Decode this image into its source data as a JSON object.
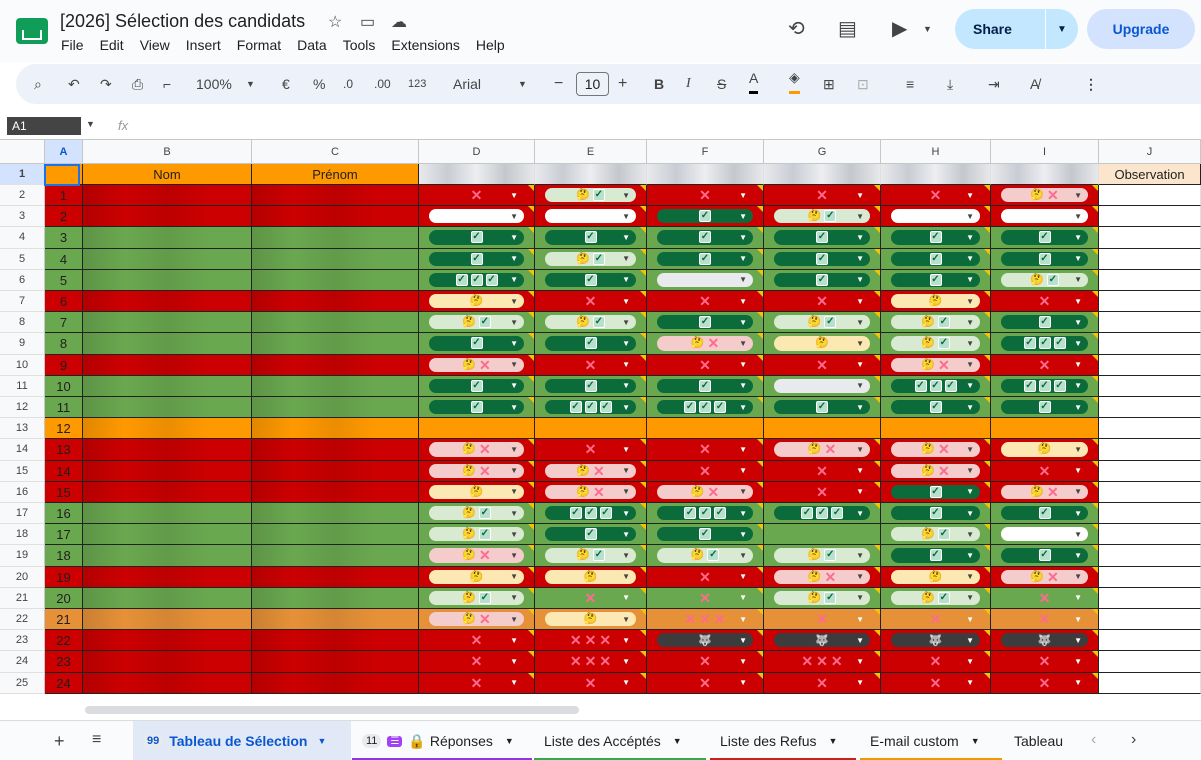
{
  "doc": {
    "title": "[2026] Sélection des candidats",
    "menu": [
      "File",
      "Edit",
      "View",
      "Insert",
      "Format",
      "Data",
      "Tools",
      "Extensions",
      "Help"
    ],
    "share_label": "Share",
    "upgrade_label": "Upgrade"
  },
  "toolbar": {
    "zoom": "100%",
    "currency": "€",
    "percent": "%",
    "dec_less": ".0",
    "dec_more": ".00",
    "number_format": "123",
    "font": "Arial",
    "font_size": "10",
    "minus": "−",
    "plus": "+"
  },
  "formula_bar": {
    "name_box": "A1",
    "fx": "fx",
    "content": ""
  },
  "columns": [
    "A",
    "B",
    "C",
    "D",
    "E",
    "F",
    "G",
    "H",
    "I",
    "J"
  ],
  "header_row": {
    "row_num": "1",
    "nom": "Nom",
    "prenom": "Prénom",
    "observation": "Observation"
  },
  "rows": [
    {
      "r": "2",
      "id": "1",
      "c": [
        "X",
        "MK",
        "X",
        "X",
        "X",
        "MX"
      ]
    },
    {
      "r": "3",
      "id": "2",
      "c": [
        "E",
        "E",
        "K",
        "MK",
        "E",
        "E"
      ]
    },
    {
      "r": "4",
      "id": "3",
      "c": [
        "K",
        "K",
        "K",
        "K",
        "K",
        "K"
      ]
    },
    {
      "r": "5",
      "id": "4",
      "c": [
        "K",
        "MK",
        "K",
        "K",
        "K",
        "K"
      ]
    },
    {
      "r": "6",
      "id": "5",
      "c": [
        "KKK",
        "K",
        "EB",
        "K",
        "K",
        "MK"
      ]
    },
    {
      "r": "7",
      "id": "6",
      "c": [
        "M",
        "X",
        "X",
        "X",
        "M",
        "X"
      ]
    },
    {
      "r": "8",
      "id": "7",
      "c": [
        "MK",
        "MK",
        "K",
        "MK",
        "MK",
        "K"
      ]
    },
    {
      "r": "9",
      "id": "8",
      "c": [
        "K",
        "K",
        "MX",
        "M",
        "MK",
        "KKK"
      ]
    },
    {
      "r": "10",
      "id": "9",
      "c": [
        "MX",
        "X",
        "X",
        "X",
        "MX",
        "X"
      ]
    },
    {
      "r": "11",
      "id": "10",
      "c": [
        "K",
        "K",
        "K",
        "EB",
        "KKK",
        "KKK"
      ]
    },
    {
      "r": "12",
      "id": "11",
      "c": [
        "K",
        "KKK",
        "KKK",
        "K",
        "K",
        "K"
      ]
    },
    {
      "r": "13",
      "id": "12",
      "c": [
        "",
        "",
        "",
        "",
        "",
        ""
      ]
    },
    {
      "r": "14",
      "id": "13",
      "c": [
        "MX",
        "X",
        "X",
        "MX",
        "MX",
        "M"
      ]
    },
    {
      "r": "15",
      "id": "14",
      "c": [
        "MX",
        "MX",
        "X",
        "X",
        "MX",
        "X"
      ]
    },
    {
      "r": "16",
      "id": "15",
      "c": [
        "M",
        "MX",
        "MX",
        "X",
        "K",
        "MX"
      ]
    },
    {
      "r": "17",
      "id": "16",
      "c": [
        "MK",
        "KKK",
        "KKK",
        "KKK",
        "K",
        "K"
      ]
    },
    {
      "r": "18",
      "id": "17",
      "c": [
        "MK",
        "K",
        "K",
        "",
        "MK",
        "E"
      ]
    },
    {
      "r": "19",
      "id": "18",
      "c": [
        "MX",
        "MK",
        "MK",
        "MK",
        "K",
        "K"
      ]
    },
    {
      "r": "20",
      "id": "19",
      "c": [
        "M",
        "M",
        "X",
        "MX",
        "M",
        "MX"
      ]
    },
    {
      "r": "21",
      "id": "20",
      "c": [
        "MK",
        "X",
        "X",
        "MK",
        "MK",
        "X"
      ]
    },
    {
      "r": "22",
      "id": "21",
      "c": [
        "MX",
        "M",
        "XXX",
        "X",
        "X",
        "X"
      ]
    },
    {
      "r": "23",
      "id": "22",
      "c": [
        "X",
        "XXX",
        "W",
        "W",
        "W",
        "W"
      ]
    },
    {
      "r": "24",
      "id": "23",
      "c": [
        "X",
        "XXX",
        "X",
        "XXX",
        "X",
        "X"
      ]
    },
    {
      "r": "25",
      "id": "24",
      "c": [
        "X",
        "X",
        "X",
        "X",
        "X",
        "X"
      ]
    }
  ],
  "sheets": [
    {
      "badge": "99",
      "label": "Tableau de Sélection",
      "color": "#0b57d0"
    },
    {
      "badge": "11",
      "label": "Réponses",
      "color": "#9334e6"
    },
    {
      "badge": "",
      "label": "Liste des Accéptés",
      "color": "#34a853"
    },
    {
      "badge": "",
      "label": "Liste des Refus",
      "color": "#c5221f"
    },
    {
      "badge": "",
      "label": "E-mail custom",
      "color": "#f29900"
    },
    {
      "badge": "",
      "label": "Tableau",
      "color": "#ffffff"
    }
  ],
  "colors": {
    "header_orange": "#ff9900",
    "row_green": "#6aa84f",
    "row_red": "#cc0000",
    "row_orange": "#e69138",
    "chip_green_dark": "#0b6b3a",
    "chip_light_green": "#d9ead3",
    "chip_pink": "#f4cccc",
    "chip_yellow": "#fce8b2"
  }
}
